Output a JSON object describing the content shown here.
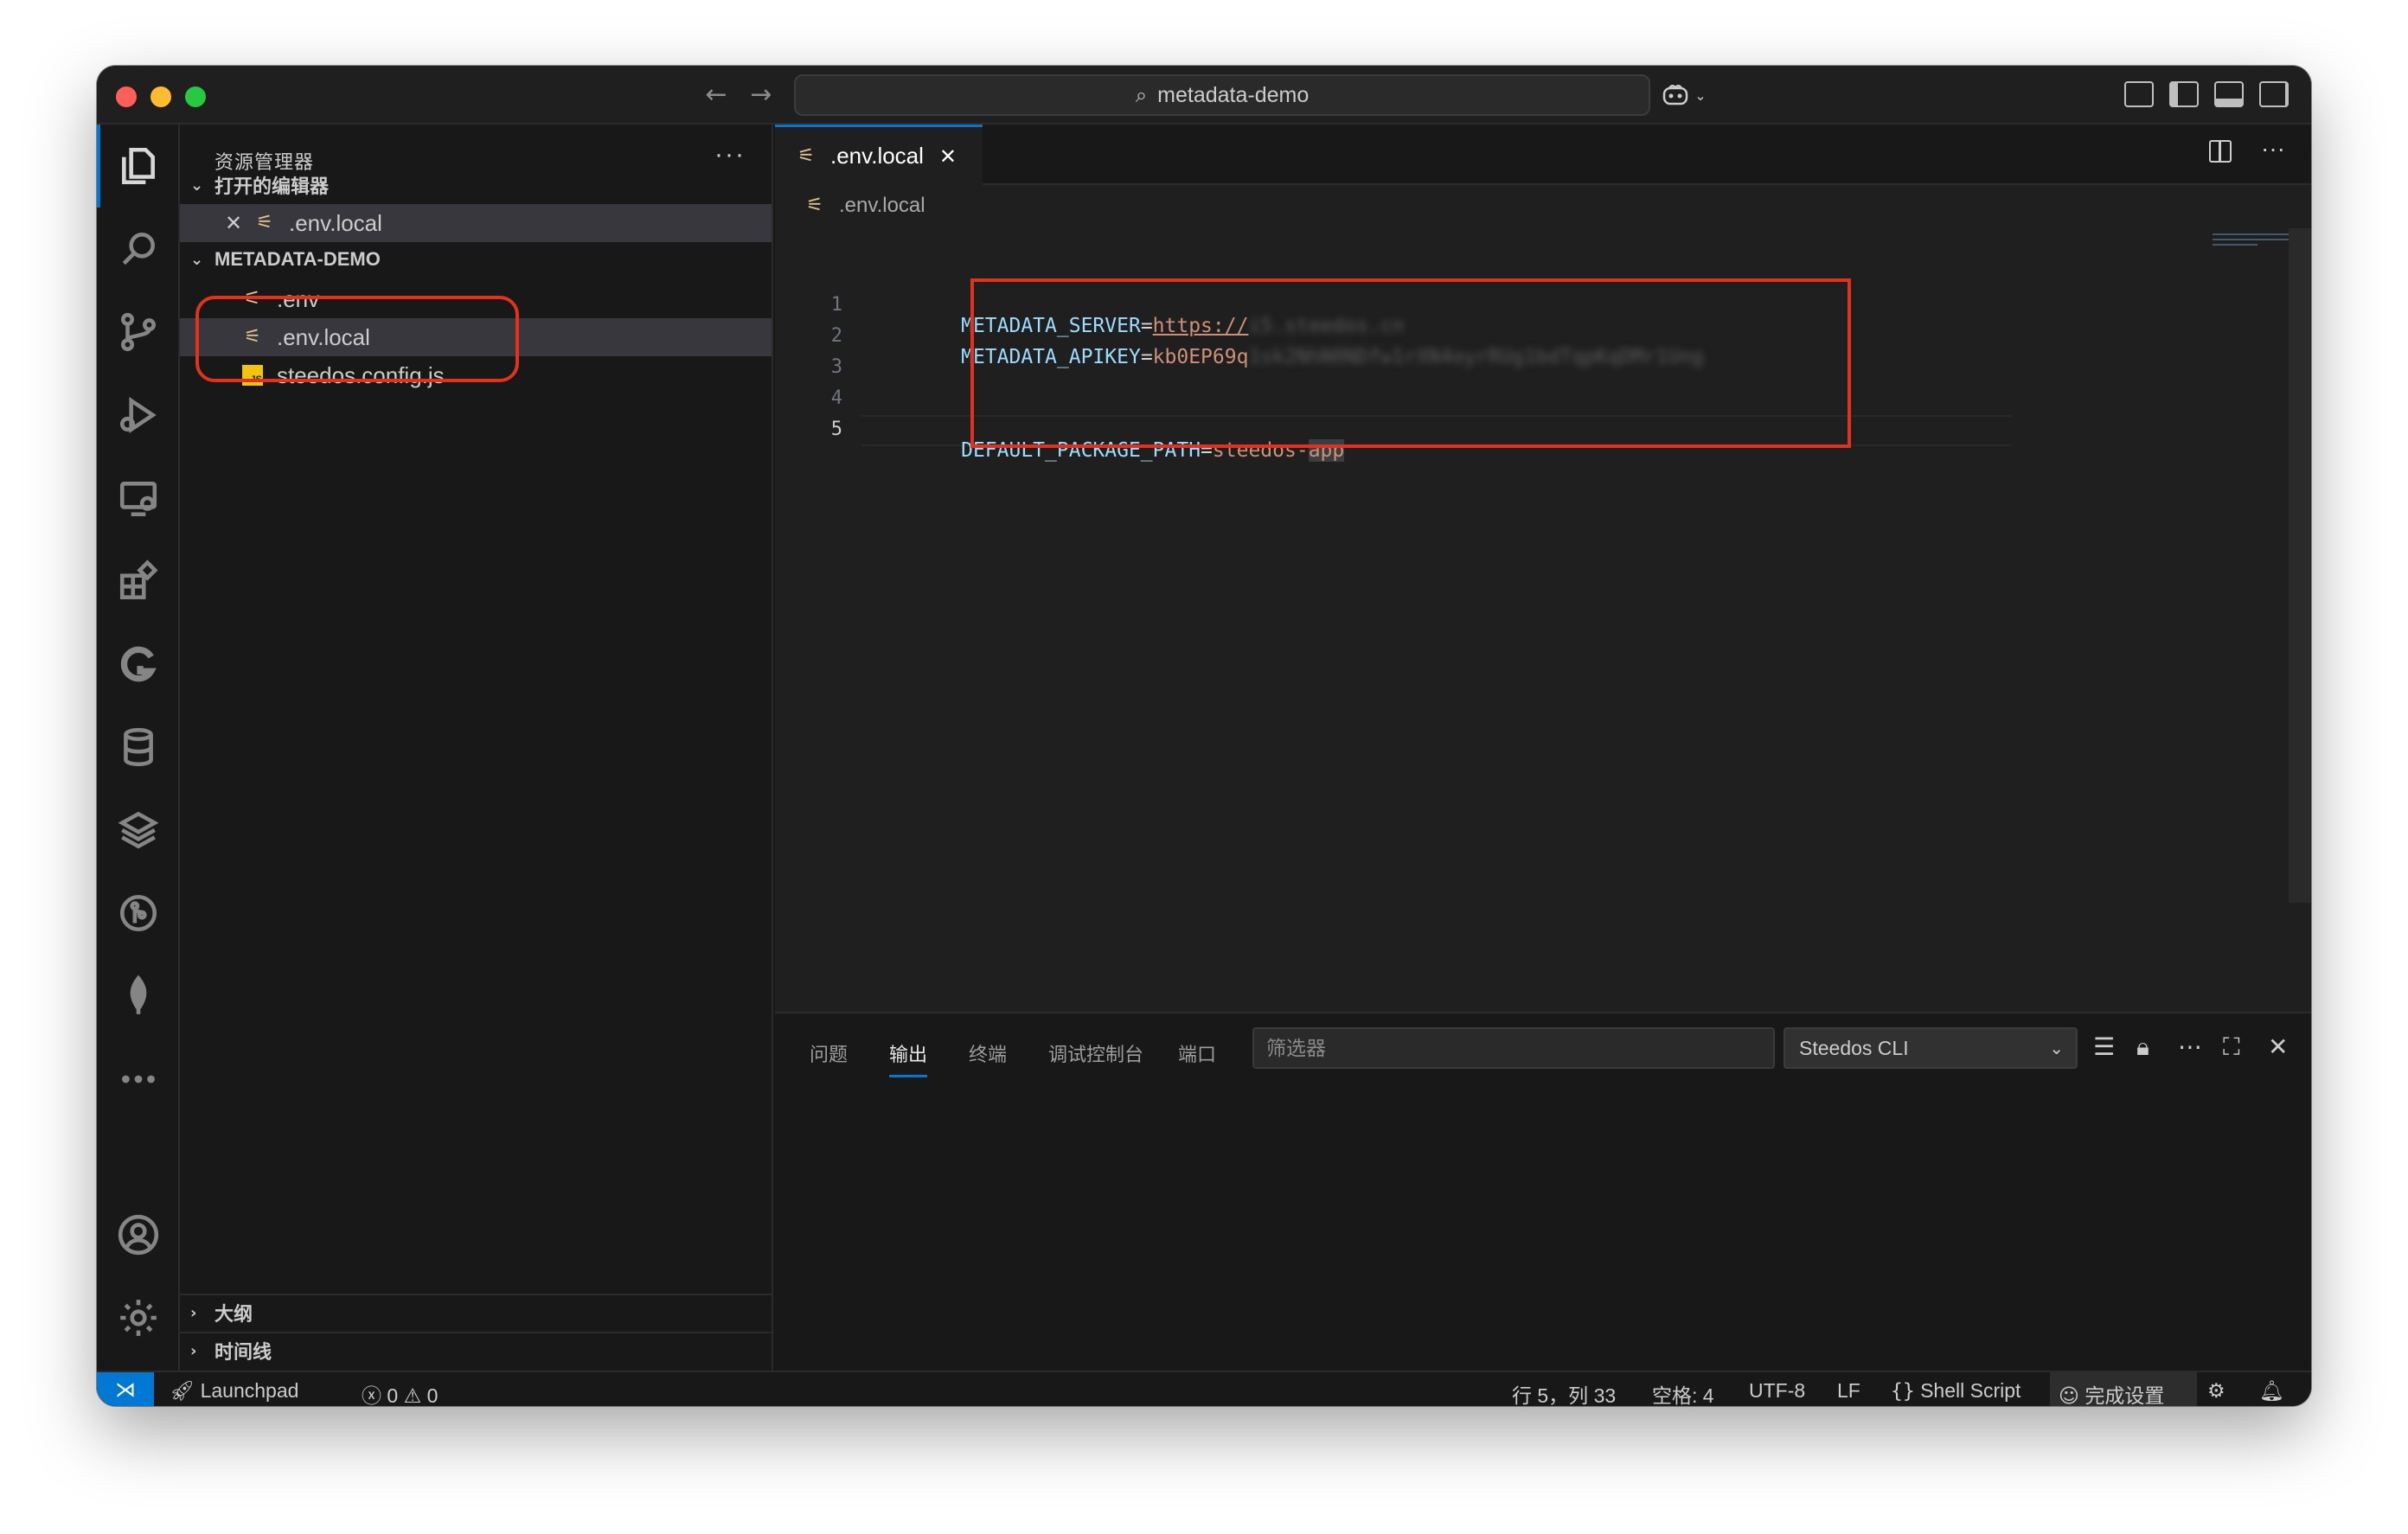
{
  "window": {
    "command_center": "metadata-demo"
  },
  "sidebar": {
    "title": "资源管理器",
    "more_label": "···",
    "open_editors": {
      "header": "打开的编辑器",
      "items": [
        ".env.local"
      ]
    },
    "project": {
      "header": "METADATA-DEMO",
      "files": [
        ".env",
        ".env.local",
        "steedos.config.js"
      ]
    },
    "outline_header": "大纲",
    "timeline_header": "时间线"
  },
  "editor": {
    "tab_label": ".env.local",
    "breadcrumb": ".env.local",
    "more_label": "···",
    "line_numbers": [
      "1",
      "2",
      "3",
      "4",
      "5"
    ],
    "lines": {
      "l1_key": "METADATA_SERVER",
      "l1_eq": "=",
      "l1_val": "https://",
      "l1_hidden": "i5.steedos.cn",
      "l2_key": "METADATA_APIKEY",
      "l2_eq": "=",
      "l2_val": "kb0EP69q",
      "l2_hidden": "1sk2NhN0NDfw1rXN4oyrRUg1bdTqpKqDMr1Ung",
      "l5_key": "DEFAULT_PACKAGE_PATH",
      "l5_eq": "=",
      "l5_val_a": "steedos-",
      "l5_val_b": "app"
    }
  },
  "panel": {
    "tabs": [
      "问题",
      "输出",
      "终端",
      "调试控制台",
      "端口"
    ],
    "active_tab": "输出",
    "filter_placeholder": "筛选器",
    "output_channel": "Steedos CLI"
  },
  "statusbar": {
    "launchpad": "Launchpad",
    "errors": "0",
    "warnings": "0",
    "cursor": "行 5，列 33",
    "indent": "空格: 4",
    "encoding": "UTF-8",
    "eol": "LF",
    "language": "Shell Script",
    "setup": "完成设置"
  },
  "colors": {
    "accent": "#0078d4",
    "annotation": "#e0321c",
    "env_icon": "#e2c08d"
  }
}
